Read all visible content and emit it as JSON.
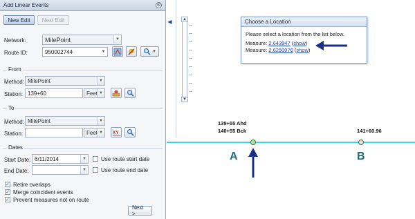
{
  "panel": {
    "title": "Add Linear Events",
    "close_icon": "⊗",
    "new_edit": "New Edit",
    "next_edit": "Next Edit",
    "network_label": "Network:",
    "network_value": "MilePoint",
    "route_label": "Route ID:",
    "route_value": "950002744",
    "from_section": "From",
    "from_method_label": "Method:",
    "from_method_value": "MilePoint",
    "from_station_label": "Station:",
    "from_station_value": "139+60",
    "from_unit": "Feet",
    "to_section": "To",
    "to_method_label": "Method:",
    "to_method_value": "MilePoint",
    "to_station_label": "Station:",
    "to_station_value": "",
    "to_unit": "Feet",
    "dates_section": "Dates",
    "start_date_label": "Start Date:",
    "start_date_value": "6/11/2014",
    "use_start_label": "Use route start date",
    "end_date_label": "End Date:",
    "end_date_value": "",
    "use_end_label": "Use route end date",
    "options": [
      {
        "label": "Retire overlaps",
        "checked": true
      },
      {
        "label": "Merge coincident events",
        "checked": true
      },
      {
        "label": "Prevent measures not on route",
        "checked": true
      }
    ],
    "next_label": "Next >"
  },
  "map": {
    "popup_title": "Choose a Location",
    "popup_prompt": "Please select a location from the list below.",
    "measures": [
      {
        "prefix": "Measure: ",
        "value": "2.643947",
        "show": "show"
      },
      {
        "prefix": "Measure: ",
        "value": "2.6250076",
        "show": "show"
      }
    ],
    "label_a_line1": "139+55 Ahd",
    "label_a_line2": "140+55 Bck",
    "label_b": "141+60.96",
    "letter_a": "A",
    "letter_b": "B",
    "road_color": "#37d7dd",
    "arrow_color": "#1a2f8a"
  }
}
